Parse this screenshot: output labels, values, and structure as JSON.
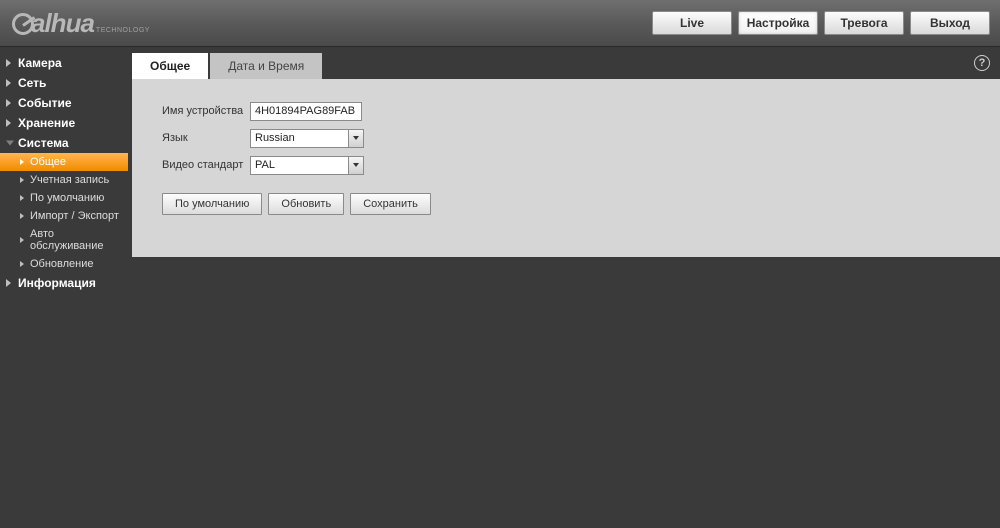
{
  "brand": {
    "name": "alhua",
    "sub": "TECHNOLOGY"
  },
  "topnav": {
    "live": "Live",
    "setup": "Настройка",
    "alarm": "Тревога",
    "logout": "Выход"
  },
  "sidebar": {
    "camera": "Камера",
    "network": "Сеть",
    "event": "Событие",
    "storage": "Хранение",
    "system": "Система",
    "system_items": {
      "general": "Общее",
      "account": "Учетная запись",
      "default": "По умолчанию",
      "import_export": "Импорт / Экспорт",
      "auto_maintain": "Авто обслуживание",
      "upgrade": "Обновление"
    },
    "information": "Информация"
  },
  "tabs": {
    "general": "Общее",
    "datetime": "Дата и Время"
  },
  "form": {
    "device_name_label": "Имя устройства",
    "device_name_value": "4H01894PAG89FAB",
    "language_label": "Язык",
    "language_value": "Russian",
    "video_std_label": "Видео стандарт",
    "video_std_value": "PAL"
  },
  "buttons": {
    "default": "По умолчанию",
    "refresh": "Обновить",
    "save": "Сохранить"
  }
}
